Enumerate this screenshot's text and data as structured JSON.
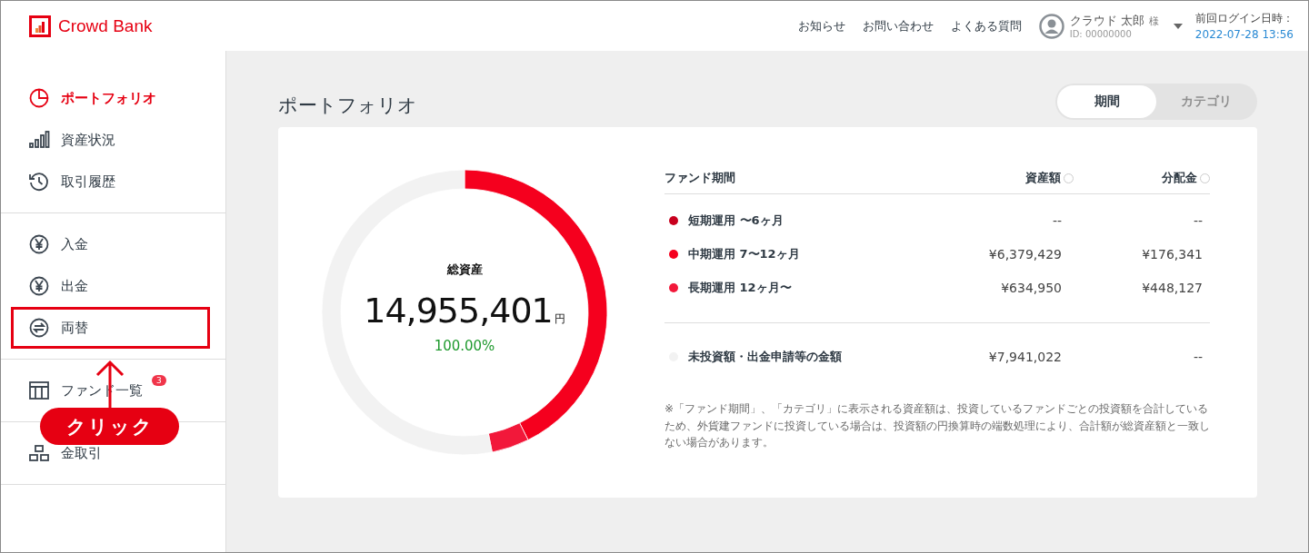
{
  "header": {
    "logo": "Crowd Bank",
    "nav": [
      "お知らせ",
      "お問い合わせ",
      "よくある質問"
    ],
    "user": {
      "name": "クラウド 太郎",
      "honorific": "様",
      "id": "ID: 00000000"
    },
    "last_login": {
      "label": "前回ログイン日時：",
      "value": "2022-07-28 13:56"
    }
  },
  "sidebar": {
    "groups": [
      {
        "items": [
          {
            "label": "ポートフォリオ",
            "selected": true,
            "highlighted": false
          },
          {
            "label": "資産状況",
            "selected": false,
            "highlighted": false
          },
          {
            "label": "取引履歴",
            "selected": false,
            "highlighted": false
          }
        ]
      },
      {
        "items": [
          {
            "label": "入金",
            "selected": false,
            "highlighted": false
          },
          {
            "label": "出金",
            "selected": false,
            "highlighted": false
          },
          {
            "label": "両替",
            "selected": false,
            "highlighted": true
          }
        ]
      },
      {
        "items": [
          {
            "label": "ファンド一覧",
            "selected": false,
            "highlighted": false,
            "badge": "3"
          }
        ]
      },
      {
        "items": [
          {
            "label": "金取引",
            "selected": false,
            "highlighted": false
          }
        ]
      }
    ]
  },
  "annotation": {
    "label": "クリック"
  },
  "page": {
    "title": "ポートフォリオ",
    "toggle": [
      {
        "label": "期間",
        "selected": true
      },
      {
        "label": "カテゴリ",
        "selected": false
      }
    ]
  },
  "summary": {
    "label": "総資産",
    "amount": "14,955,401",
    "unit": "円",
    "percent": "100.00%",
    "chart_data": {
      "type": "donut",
      "values": [
        0,
        42.65,
        4.25,
        53.1
      ]
    }
  },
  "table": {
    "columns": [
      "ファンド期間",
      "資産額",
      "分配金"
    ],
    "rows": [
      {
        "name": "短期運用 〜6ヶ月",
        "color": "#c8001e",
        "amount": "--",
        "dividend": "--"
      },
      {
        "name": "中期運用 7〜12ヶ月",
        "color": "#f5001e",
        "amount": "¥6,379,429",
        "dividend": "¥176,341"
      },
      {
        "name": "長期運用 12ヶ月〜",
        "color": "#f2183a",
        "amount": "¥634,950",
        "dividend": "¥448,127"
      }
    ],
    "other": {
      "name": "未投資額・出金申請等の金額",
      "color": "#f2f2f2",
      "amount": "¥7,941,022",
      "dividend": "--"
    },
    "note": "※「ファンド期間」、「カテゴリ」に表示される資産額は、投資しているファンドごとの投資額を合計しているため、外貨建ファンドに投資している場合は、投資額の円換算時の端数処理により、合計額が総資産額と一致しない場合があります。"
  }
}
